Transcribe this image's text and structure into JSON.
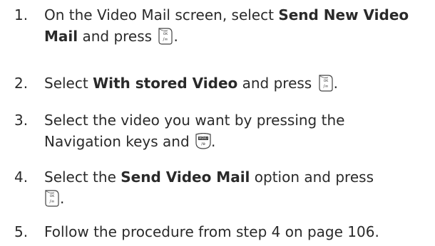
{
  "steps": [
    {
      "number": "1.",
      "part1": "On the Video Mail screen, select ",
      "bold1": "Send New Video Mail",
      "part2": " and press ",
      "key": "ok-key-icon",
      "end": "."
    },
    {
      "number": "2.",
      "part1": "Select ",
      "bold1": "With stored Video",
      "part2": " and press ",
      "key": "ok-key-icon",
      "end": "."
    },
    {
      "number": "3.",
      "part1": "Select the video you want by pressing the Navigation keys and ",
      "key": "menu-key-icon",
      "end": "."
    },
    {
      "number": "4.",
      "part1": "Select the ",
      "bold1": "Send Video Mail",
      "part2": " option and press",
      "key": "ok-key-icon",
      "end": "."
    },
    {
      "number": "5.",
      "part1": "Follow the procedure from step 4 on page 106."
    }
  ]
}
